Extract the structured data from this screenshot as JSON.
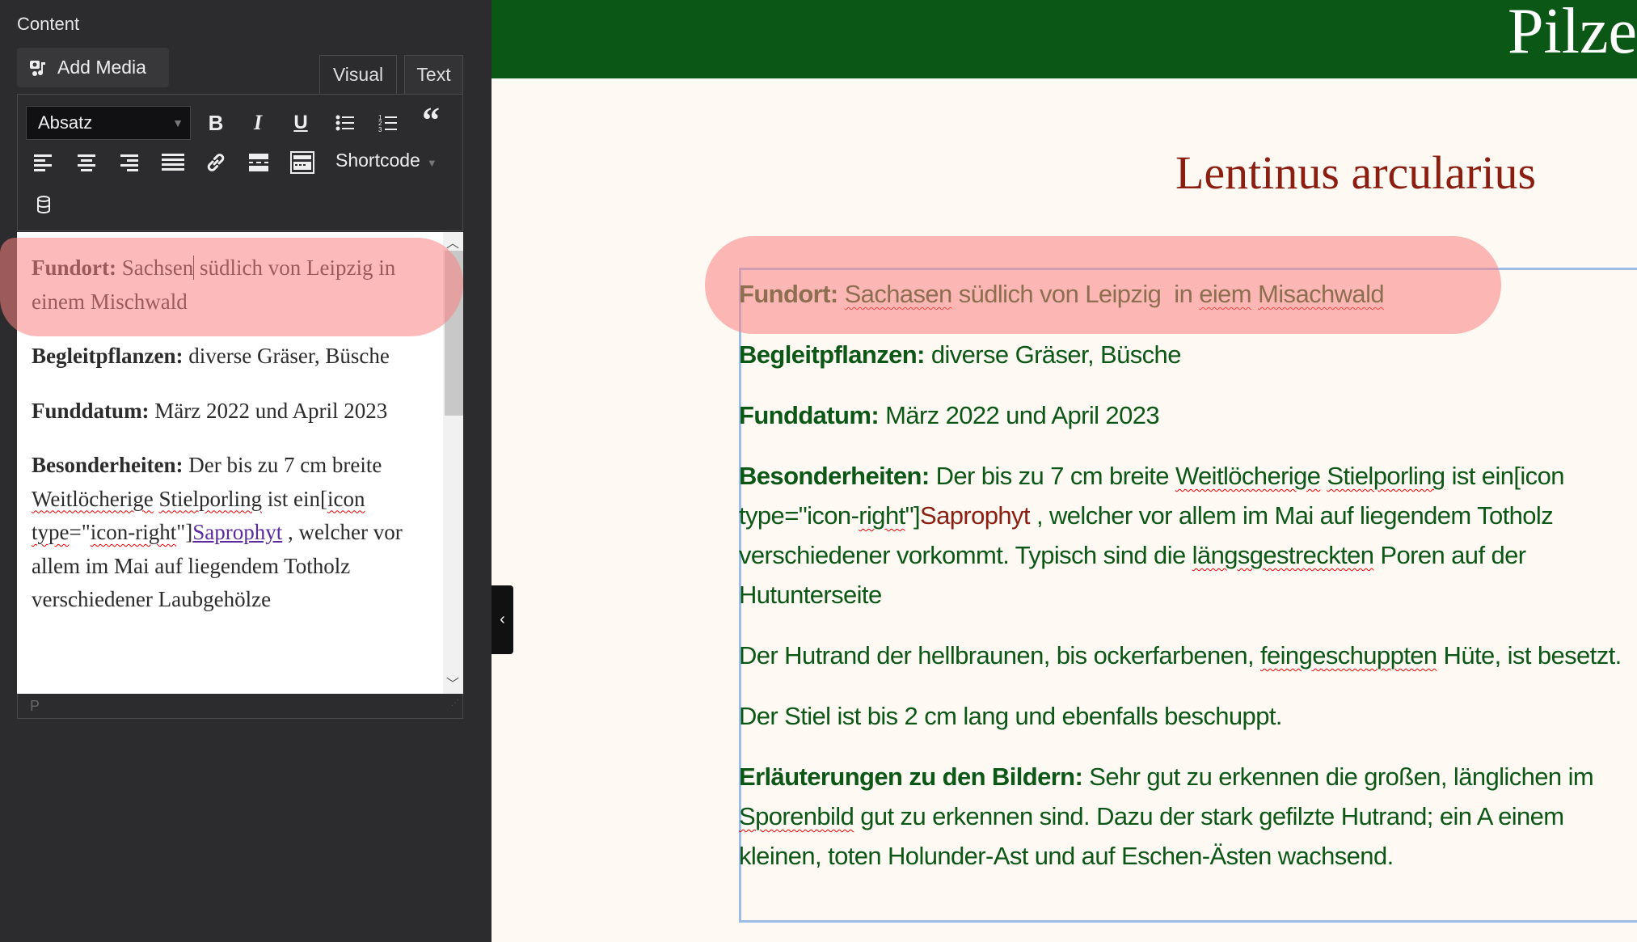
{
  "editor": {
    "section_label": "Content",
    "add_media_label": "Add Media",
    "tabs": [
      {
        "label": "Visual"
      },
      {
        "label": "Text"
      }
    ],
    "format_select": "Absatz",
    "shortcode_label": "Shortcode",
    "status_path": "P",
    "paragraphs": {
      "p1": {
        "label": "Fundort:",
        "t1": "Sachsen",
        "t2": "südlich von Leipzig in einem Mischwald"
      },
      "p2": {
        "label": "Begleitpflanzen:",
        "text": "diverse Gräser, Büsche"
      },
      "p3": {
        "label": "Funddatum:",
        "text": "März 2022 und April 2023"
      },
      "p4": {
        "label": "Besonderheiten:",
        "a": "Der bis zu 7 cm breite",
        "w1": "Weitlöcherige",
        "w2": "Stielporling",
        "b": "ist ein[",
        "w3": "icon",
        "w4": "type",
        "c": "=\"",
        "w5": "icon-right",
        "d": "\"]",
        "link": "Saprophyt",
        "e": " , welcher vor allem im Mai auf liegendem Totholz verschiedener Laubgehölze"
      }
    }
  },
  "site": {
    "title": "Pilze",
    "page_title": "Lentinus arcularius",
    "colors": {
      "header": "#0b5716",
      "title": "#8b1e10",
      "text": "#0b5716",
      "highlight": "#fa8282"
    }
  },
  "preview": {
    "l1": {
      "label": "Fundort:",
      "w1": "Sachasen",
      "a": "südlich von Leipzig  in",
      "w2": "eiem",
      "w3": "Misachwald"
    },
    "l2": {
      "label": "Begleitpflanzen:",
      "text": "diverse Gräser, Büsche"
    },
    "l3": {
      "label": "Funddatum:",
      "text": "März 2022 und April 2023"
    },
    "l4": {
      "label": "Besonderheiten:",
      "a": "Der bis zu 7 cm breite",
      "w1": "Weitlöcherige",
      "w2": "Stielporling",
      "b": "ist ein[icon type=\"icon-"
    },
    "l5": {
      "w1": "right",
      "a": "\"]",
      "red": "Saprophyt",
      "b": " , welcher vor allem im Mai auf liegendem Totholz verschiedener"
    },
    "l6": {
      "a": "vorkommt. Typisch sind die",
      "w1": "längsgestreckten",
      "b": "Poren auf der Hutunterseite"
    },
    "l7": {
      "a": "Der Hutrand der hellbraunen, bis ockerfarbenen,",
      "w1": "feingeschuppten",
      "b": "Hüte, ist"
    },
    "l8": {
      "text": "besetzt."
    },
    "l9": {
      "text": "Der Stiel ist bis 2 cm lang und ebenfalls beschuppt."
    },
    "l10": {
      "label": "Erläuterungen zu den Bildern:",
      "text": "Sehr gut zu erkennen die großen, länglichen"
    },
    "l11": {
      "a": "im",
      "w1": "Sporenbild",
      "b": "gut zu erkennen sind. Dazu der stark gefilzte Hutrand; ein A"
    },
    "l12": {
      "text": "einem kleinen, toten Holunder-Ast und auf Eschen-Ästen wachsend."
    }
  }
}
